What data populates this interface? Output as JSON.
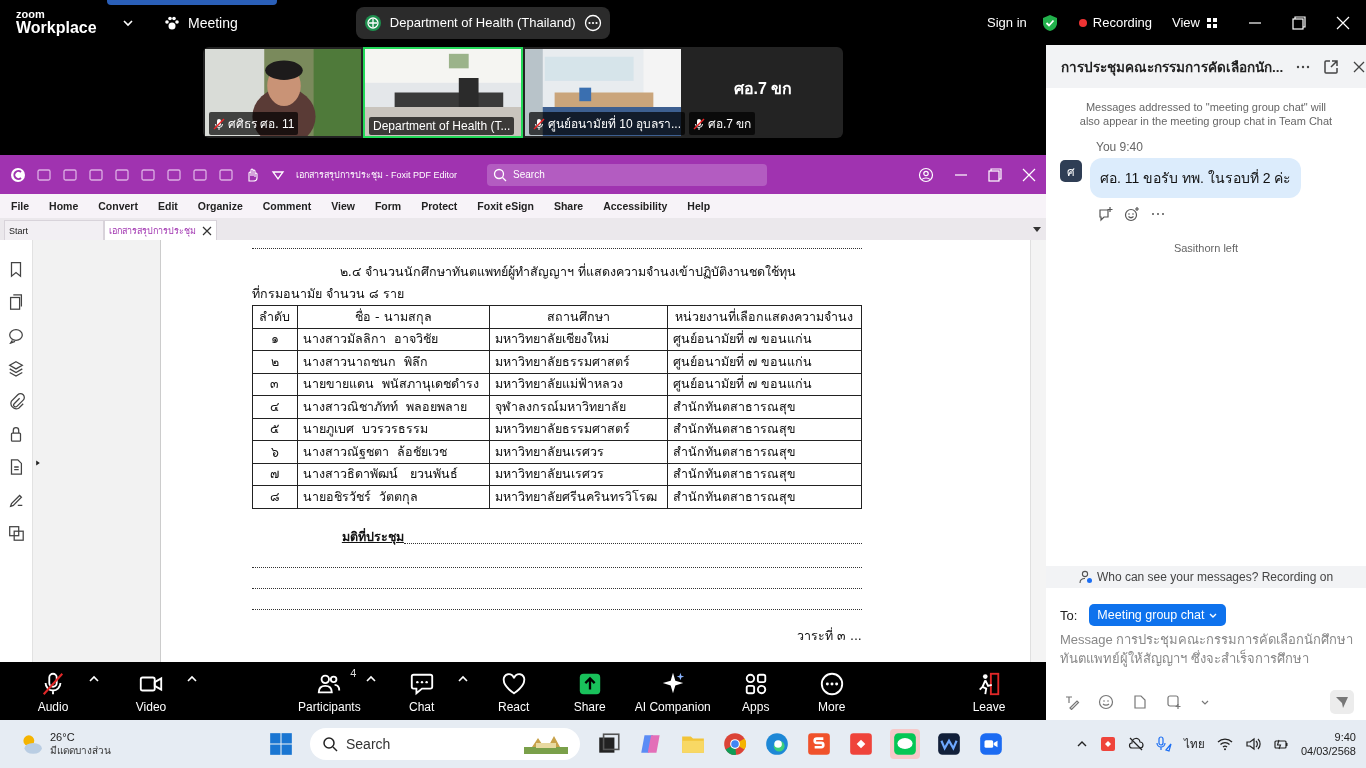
{
  "zoom_bar": {
    "logo_top": "zoom",
    "logo_bottom": "Workplace",
    "meeting_label": "Meeting",
    "meeting_title": "Department of Health (Thailand)",
    "sign_in": "Sign in",
    "recording": "Recording",
    "view": "View"
  },
  "video_tiles": [
    {
      "kind": "picture",
      "name": "ศศิธร ศอ. 11",
      "muted": true,
      "active": false
    },
    {
      "kind": "picture",
      "name": "Department of Health (T...",
      "muted": false,
      "active": true
    },
    {
      "kind": "picture",
      "name": "ศูนย์อนามัยที่ 10 อุบลรา...",
      "muted": true,
      "active": false
    },
    {
      "kind": "text",
      "title": "ศอ.7 ขก",
      "name": "ศอ.7 ขก",
      "muted": true,
      "active": false
    }
  ],
  "pdf_editor": {
    "title": "เอกสารสรุปการประชุม - Foxit PDF Editor",
    "search_placeholder": "Search",
    "menu": [
      "File",
      "Home",
      "Convert",
      "Edit",
      "Organize",
      "Comment",
      "View",
      "Form",
      "Protect",
      "Foxit eSign",
      "Share",
      "Accessibility",
      "Help"
    ],
    "tabs": [
      {
        "label": "Start",
        "selected": false
      },
      {
        "label": "เอกสารสรุปการประชุม",
        "selected": true
      }
    ]
  },
  "document": {
    "paragraph_first": "๒.๔ จำนวนนักศึกษาทันตแพทย์ผู้ทำสัญญาฯ ที่แสดงความจำนงเข้าปฏิบัติงานชดใช้ทุน",
    "paragraph_rest": "ที่กรมอนามัย จำนวน ๘ ราย",
    "table": {
      "columns": [
        "ลำดับ",
        "ชื่อ - นามสกุล",
        "สถานศึกษา",
        "หน่วยงานที่เลือกแสดงความจำนง"
      ],
      "rows": [
        [
          "๑",
          "นางสาวมัลลิกา  อาจวิชัย",
          "มหาวิทยาลัยเชียงใหม่",
          "ศูนย์อนามัยที่ ๗ ขอนแก่น"
        ],
        [
          "๒",
          "นางสาวนาถชนก  พิลึก",
          "มหาวิทยาลัยธรรมศาสตร์",
          "ศูนย์อนามัยที่ ๗ ขอนแก่น"
        ],
        [
          "๓",
          "นายขายแดน  พนัสภานุเดชดำรง",
          "มหาวิทยาลัยแม่ฟ้าหลวง",
          "ศูนย์อนามัยที่ ๗ ขอนแก่น"
        ],
        [
          "๔",
          "นางสาวณิชาภัทท์  พลอยพลาย",
          "จุฬาลงกรณ์มหาวิทยาลัย",
          "สำนักทันตสาธารณสุข"
        ],
        [
          "๕",
          "นายภูเบศ  บวรวรธรรม",
          "มหาวิทยาลัยธรรมศาสตร์",
          "สำนักทันตสาธารณสุข"
        ],
        [
          "๖",
          "นางสาวณัฐชตา  ล้อชัยเวช",
          "มหาวิทยาลัยนเรศวร",
          "สำนักทันตสาธารณสุข"
        ],
        [
          "๗",
          "นางสาวธิดาพัฒน์   ยวนพันธ์",
          "มหาวิทยาลัยนเรศวร",
          "สำนักทันตสาธารณสุข"
        ],
        [
          "๘",
          "นายอชิรวัชร์  วัตตกุล",
          "มหาวิทยาลัยศรีนครินทรวิโรฒ",
          "สำนักทันตสาธารณสุข"
        ]
      ]
    },
    "resolution_label": "มติที่ประชุม",
    "footer": "วาระที่ ๓ ..."
  },
  "toolbar": [
    {
      "kind": "audio",
      "label": "Audio",
      "muted": true,
      "caret": true
    },
    {
      "kind": "video",
      "label": "Video",
      "caret": true
    },
    {
      "kind": "participants",
      "label": "Participants",
      "count": "4",
      "caret": true
    },
    {
      "kind": "chat",
      "label": "Chat",
      "caret": true
    },
    {
      "kind": "react",
      "label": "React",
      "caret": false
    },
    {
      "kind": "share",
      "label": "Share",
      "caret": false
    },
    {
      "kind": "ai",
      "label": "AI Companion",
      "caret": false
    },
    {
      "kind": "apps",
      "label": "Apps",
      "caret": false
    },
    {
      "kind": "more",
      "label": "More",
      "caret": false
    },
    {
      "kind": "leave",
      "label": "Leave",
      "caret": false
    }
  ],
  "chat": {
    "title": "การประชุมคณะกรรมการคัดเลือกนัก...",
    "notice": "Messages addressed to \"meeting group chat\" will also appear in the meeting group chat in Team Chat",
    "message": {
      "sender": "You",
      "time": "9:40",
      "avatar": "ศ",
      "text": "ศอ. 11 ขอรับ ทพ. ในรอบที่ 2 ค่ะ"
    },
    "event": "Sasithorn left",
    "privacy": "Who can see your messages? Recording on",
    "to_label": "To:",
    "recipient": "Meeting group chat",
    "placeholder": "Message การประชุมคณะกรรมการคัดเลือกนักศึกษาทันตแพทย์ผู้ให้สัญญาฯ ซึ่งจะสำเร็จการศึกษา"
  },
  "taskbar": {
    "temperature": "26°C",
    "weather": "มีแดดบางส่วน",
    "search_placeholder": "Search",
    "language": "ไทย",
    "time": "9:40",
    "date": "04/03/2568"
  }
}
